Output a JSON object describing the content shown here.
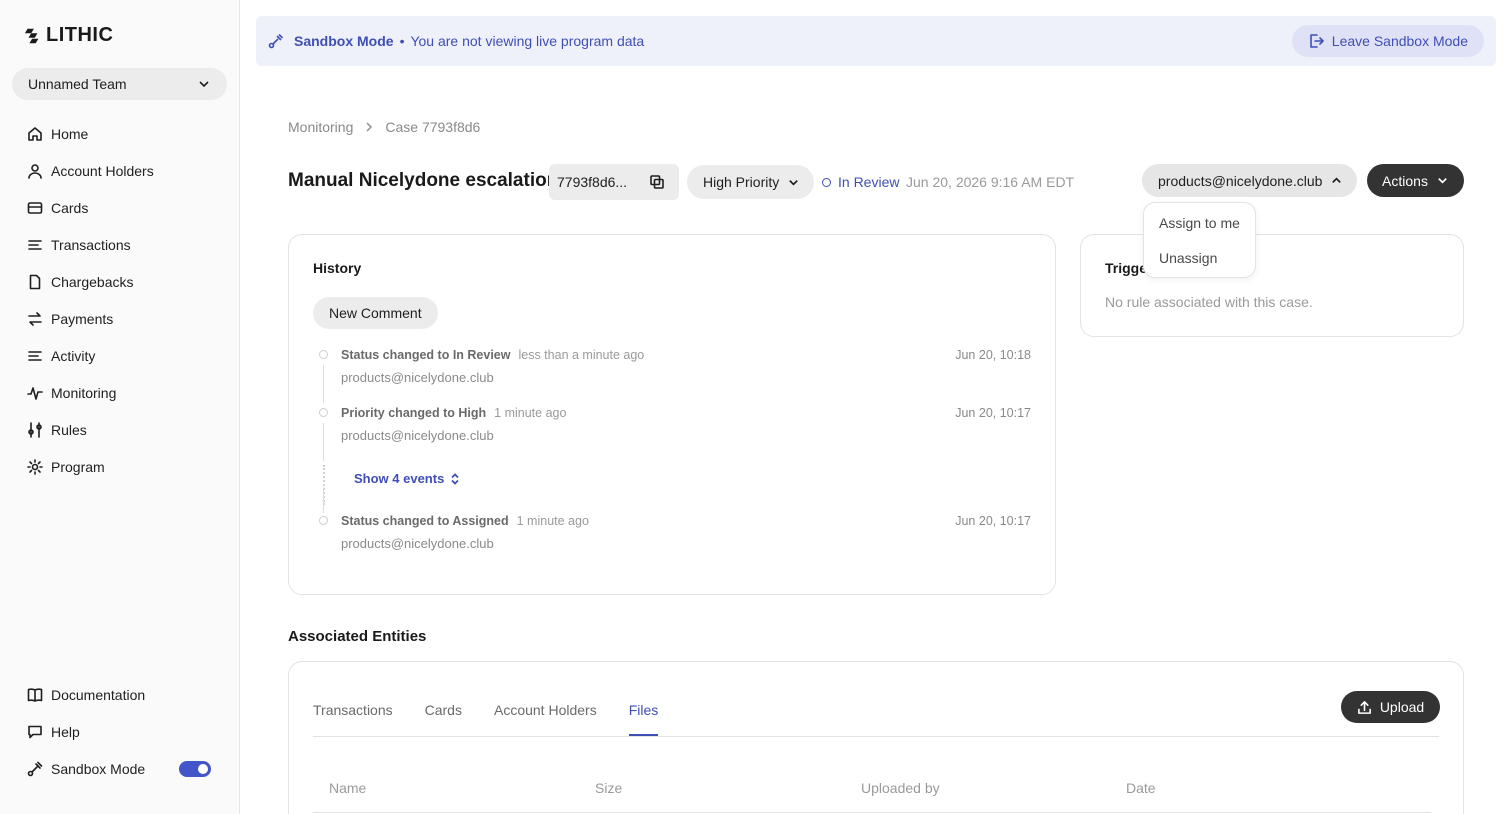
{
  "brand": {
    "name": "LITHIC"
  },
  "team": {
    "name": "Unnamed Team"
  },
  "nav": {
    "items": [
      {
        "label": "Home",
        "icon": "home-icon"
      },
      {
        "label": "Account Holders",
        "icon": "user-icon"
      },
      {
        "label": "Cards",
        "icon": "card-icon"
      },
      {
        "label": "Transactions",
        "icon": "list-icon"
      },
      {
        "label": "Chargebacks",
        "icon": "document-icon"
      },
      {
        "label": "Payments",
        "icon": "arrows-icon"
      },
      {
        "label": "Activity",
        "icon": "list-icon"
      },
      {
        "label": "Monitoring",
        "icon": "pulse-icon"
      },
      {
        "label": "Rules",
        "icon": "sliders-icon"
      },
      {
        "label": "Program",
        "icon": "gear-icon"
      }
    ],
    "bottom": [
      {
        "label": "Documentation",
        "icon": "book-icon"
      },
      {
        "label": "Help",
        "icon": "chat-icon"
      },
      {
        "label": "Sandbox Mode",
        "icon": "sandbox-icon",
        "toggle_on": true
      }
    ]
  },
  "banner": {
    "mode": "Sandbox Mode",
    "separator": "•",
    "message": "You are not viewing live program data",
    "leave_label": "Leave Sandbox Mode"
  },
  "breadcrumb": {
    "parent": "Monitoring",
    "current": "Case 7793f8d6"
  },
  "case": {
    "title": "Manual Nicelydone escalation",
    "id_short": "7793f8d6...",
    "priority": "High Priority",
    "status": "In Review",
    "date": "Jun 20, 2026 9:16 AM EDT",
    "assignee": "products@nicelydone.club",
    "actions_label": "Actions"
  },
  "assignee_menu": {
    "items": [
      "Assign to me",
      "Unassign"
    ]
  },
  "history": {
    "heading": "History",
    "new_comment_label": "New Comment",
    "events": [
      {
        "title": "Status changed to In Review",
        "ago": "less than a minute ago",
        "user": "products@nicelydone.club",
        "date": "Jun 20, 10:18"
      },
      {
        "title": "Priority changed to High",
        "ago": "1 minute ago",
        "user": "products@nicelydone.club",
        "date": "Jun 20, 10:17"
      },
      {
        "title": "Status changed to Assigned",
        "ago": "1 minute ago",
        "user": "products@nicelydone.club",
        "date": "Jun 20, 10:17"
      }
    ],
    "show_events_label": "Show 4 events"
  },
  "trigger": {
    "heading": "Trigger",
    "text": "No rule associated with this case."
  },
  "entities": {
    "heading": "Associated Entities",
    "tabs": [
      "Transactions",
      "Cards",
      "Account Holders",
      "Files"
    ],
    "active_tab": "Files",
    "upload_label": "Upload",
    "columns": [
      "Name",
      "Size",
      "Uploaded by",
      "Date"
    ]
  },
  "colors": {
    "accent": "#3f4fb5",
    "banner_bg": "#eef0fa",
    "dark_button": "#333333"
  }
}
